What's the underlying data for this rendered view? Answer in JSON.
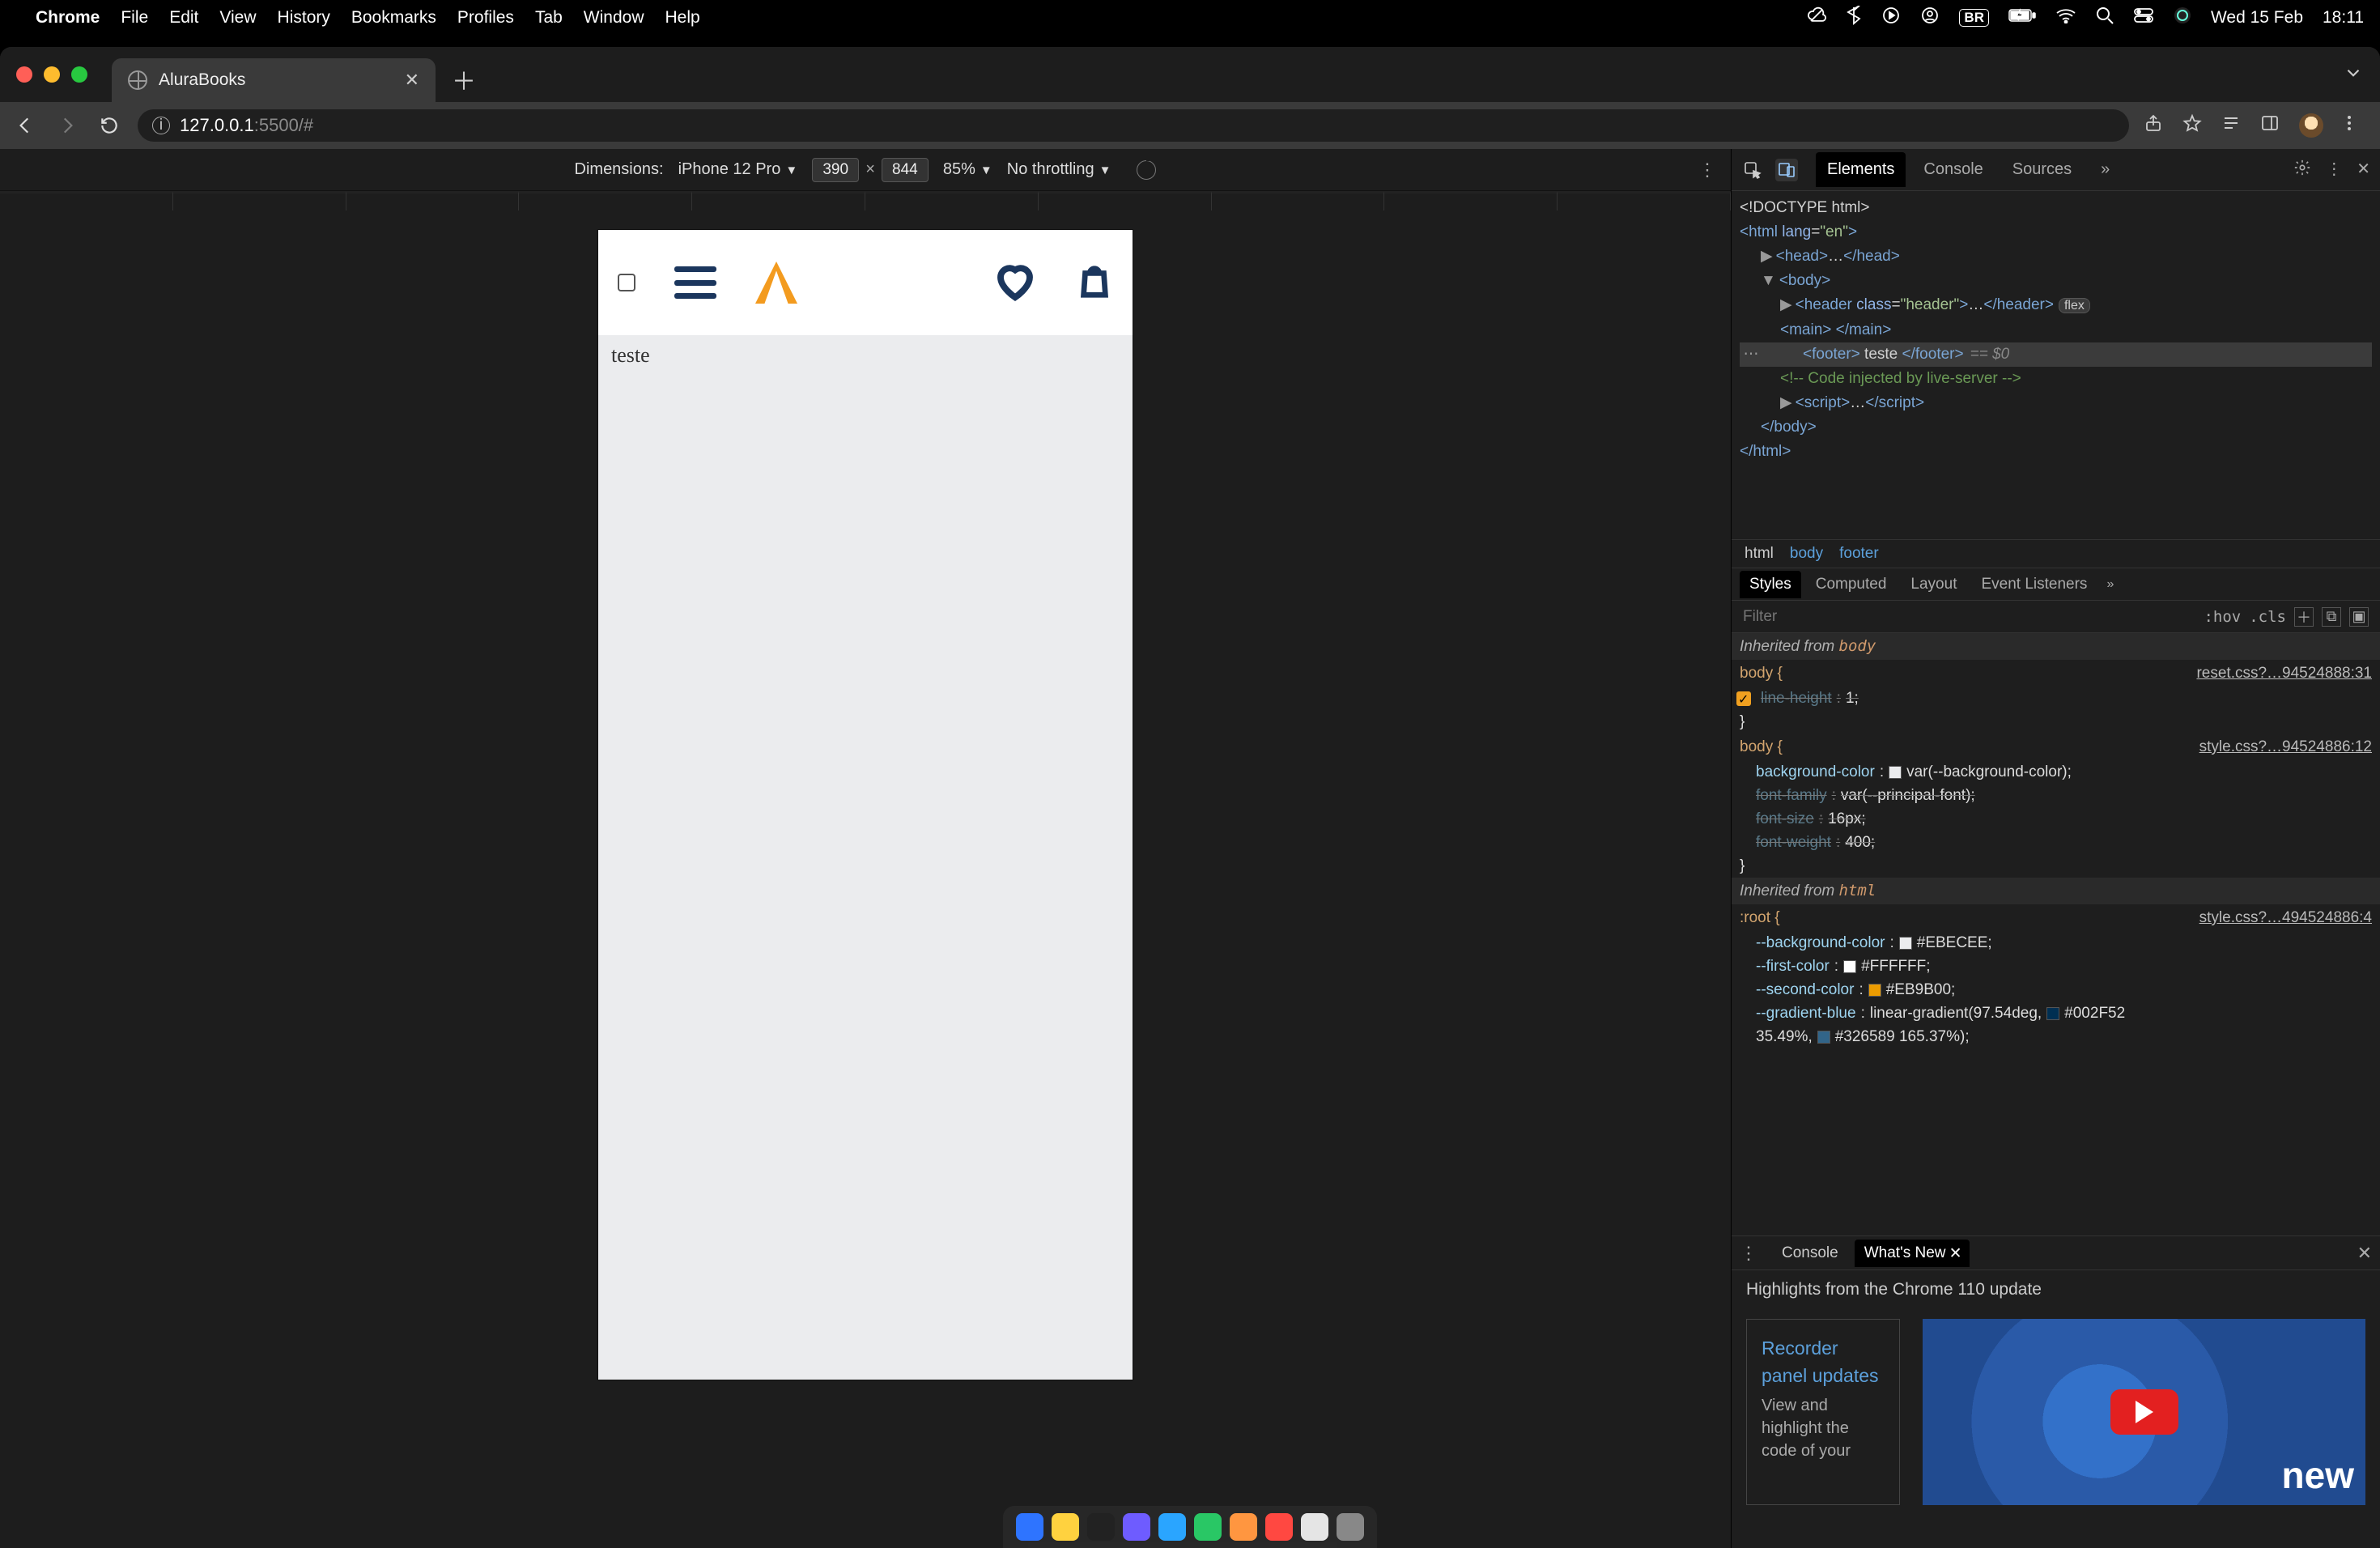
{
  "menubar": {
    "app": "Chrome",
    "items": [
      "File",
      "Edit",
      "View",
      "History",
      "Bookmarks",
      "Profiles",
      "Tab",
      "Window",
      "Help"
    ],
    "input_badge": "BR",
    "day_date": "Wed 15 Feb",
    "time": "18:11"
  },
  "tab": {
    "title": "AluraBooks"
  },
  "address": {
    "host": "127.0.0.1",
    "rest": ":5500/#"
  },
  "device_toolbar": {
    "label": "Dimensions:",
    "device": "iPhone 12 Pro",
    "width": "390",
    "height": "844",
    "zoom": "85%",
    "throttling": "No throttling"
  },
  "preview": {
    "footer_text": "teste"
  },
  "devtools": {
    "tabs": [
      "Elements",
      "Console",
      "Sources"
    ],
    "active_tab": "Elements",
    "dom": {
      "l1": "<!DOCTYPE html>",
      "l2_open": "<html ",
      "l2_attr": "lang",
      "l2_val": "\"en\"",
      "l2_close": ">",
      "l3": "<head>",
      "l3_dots": "…",
      "l3_close": "</head>",
      "l4": "<body>",
      "l5_open": "<header ",
      "l5_attr": "class",
      "l5_val": "\"header\"",
      "l5_close": ">",
      "l5_dots": "…",
      "l5_end": "</header>",
      "l5_pill": "flex",
      "l6": "<main> </main>",
      "l7_open": "<footer>",
      "l7_text": " teste ",
      "l7_close": "</footer>",
      "l7_eq": "== $0",
      "l8": "<!-- Code injected by live-server -->",
      "l9": "<script>",
      "l9_dots": "…",
      "l9_close": "</script>",
      "l10": "</body>",
      "l11": "</html>"
    },
    "breadcrumb": [
      "html",
      "body",
      "footer"
    ],
    "styles_tabs": [
      "Styles",
      "Computed",
      "Layout",
      "Event Listeners"
    ],
    "filter_placeholder": "Filter",
    "hov_label": ":hov",
    "cls_label": ".cls",
    "rules": {
      "inherited_body": "Inherited from ",
      "inherited_body_el": "body",
      "inherited_html": "Inherited from ",
      "inherited_html_el": "html",
      "r1_sel": "body {",
      "r1_src": "reset.css?…94524888:31",
      "r1_p1_name": "line-height",
      "r1_p1_val": "1;",
      "r2_sel": "body {",
      "r2_src": "style.css?…94524886:12",
      "r2_p1_name": "background-color",
      "r2_p1_val": "var(--background-color);",
      "r2_p2_name": "font-family",
      "r2_p2_val": "var(--principal-font);",
      "r2_p3_name": "font-size",
      "r2_p3_val": "16px;",
      "r2_p4_name": "font-weight",
      "r2_p4_val": "400;",
      "r3_sel": ":root {",
      "r3_src": "style.css?…494524886:4",
      "r3_p1_name": "--background-color",
      "r3_p1_val": "#EBECEE;",
      "r3_p2_name": "--first-color",
      "r3_p2_val": "#FFFFFF;",
      "r3_p3_name": "--second-color",
      "r3_p3_val": "#EB9B00;",
      "r3_p4_name": "--gradient-blue",
      "r3_p4_val_a": "linear-gradient(97.54deg, ",
      "r3_p4_val_b": "#002F52",
      "r3_p4_val_c": " 35.49%, ",
      "r3_p4_val_d": "#326589 165.37%);"
    },
    "drawer": {
      "tabs": [
        "Console",
        "What's New"
      ],
      "active": "What's New",
      "headline": "Highlights from the Chrome 110 update",
      "card_title": "Recorder panel updates",
      "card_sub": "View and highlight the code of your",
      "video_text": "new"
    }
  }
}
